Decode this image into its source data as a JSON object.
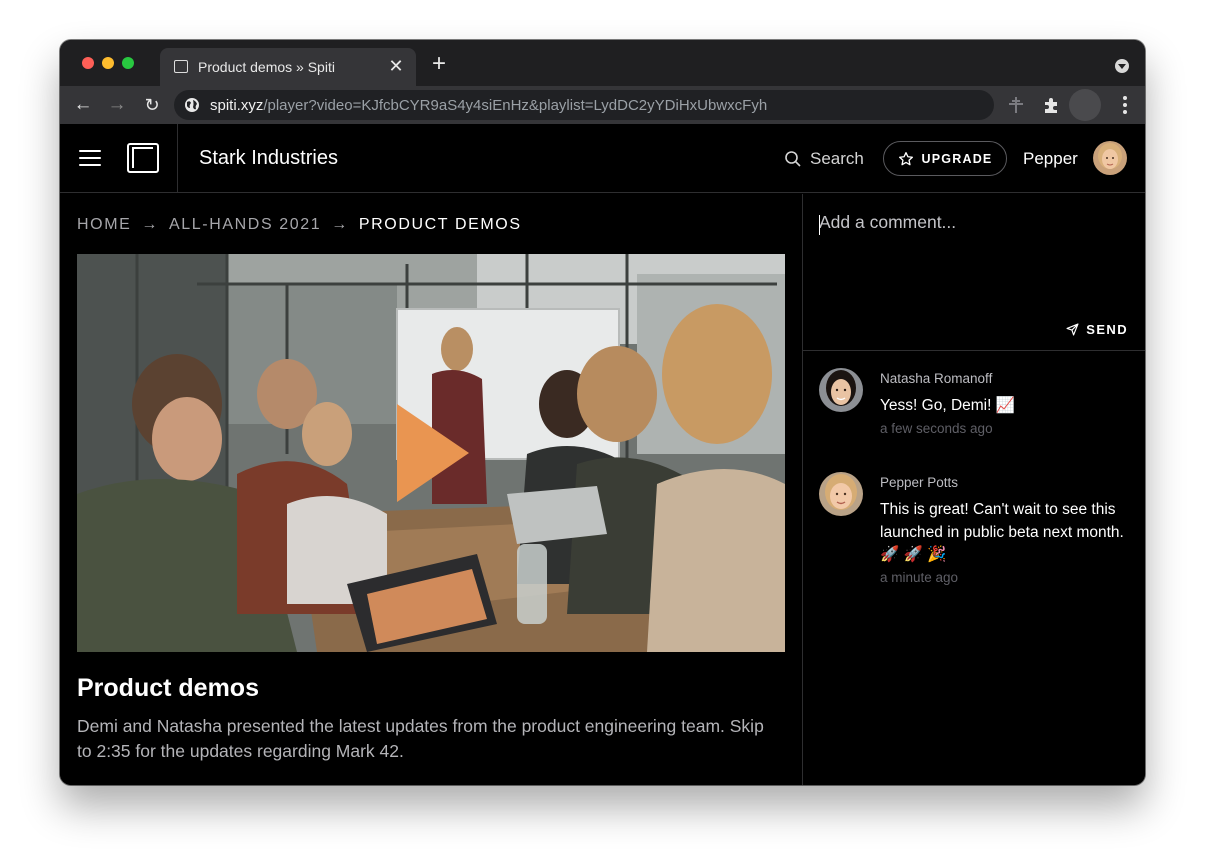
{
  "browser": {
    "tab_title": "Product demos » Spiti",
    "tab_close": "✕",
    "new_tab": "+",
    "url_host": "spiti.xyz",
    "url_path": "/player?video=KJfcbCYR9aS4y4siEnHz&playlist=LydDC2yYDiHxUbwxcFyh",
    "icons": [
      "globe-icon",
      "translate-icon",
      "extensions-icon",
      "profile-icon",
      "menu-icon"
    ]
  },
  "appbar": {
    "brand": "Stark Industries",
    "search_label": "Search",
    "upgrade_label": "UPGRADE",
    "username": "Pepper"
  },
  "breadcrumb": {
    "items": [
      "HOME",
      "ALL-HANDS 2021",
      "PRODUCT DEMOS"
    ],
    "separator": "→"
  },
  "video": {
    "title": "Product demos",
    "description": "Demi and Natasha presented the latest updates from the product engineering team. Skip to 2:35 for the updates regarding Mark 42.",
    "play_color": "#e99551"
  },
  "comments_panel": {
    "input_placeholder": "Add a comment...",
    "send_label": "SEND",
    "comments": [
      {
        "author": "Natasha Romanoff",
        "body": "Yess! Go, Demi! 📈",
        "time": "a few seconds ago"
      },
      {
        "author": "Pepper Potts",
        "body": "This is great! Can't wait to see this launched in public beta next month. 🚀 🚀 🎉",
        "time": "a minute ago"
      }
    ]
  },
  "colors": {
    "background": "#000000",
    "divider": "#2e2e30",
    "accent_play": "#e99551"
  }
}
